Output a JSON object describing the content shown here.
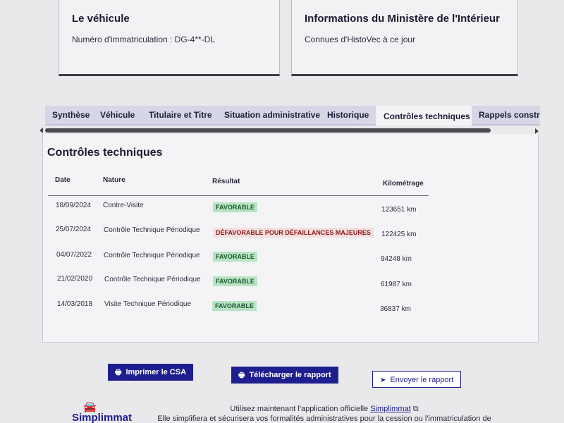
{
  "vehicle_card": {
    "title": "Le véhicule",
    "plate_line": "Numéro d'immatriculation : DG-4**-DL"
  },
  "ministry_card": {
    "title": "Informations du Ministère de l'Intérieur",
    "subtitle": "Connues d'HistoVec à ce jour"
  },
  "tabs": [
    {
      "label": "Synthèse"
    },
    {
      "label": "Véhicule"
    },
    {
      "label": "Titulaire et Titre"
    },
    {
      "label": "Situation administrative"
    },
    {
      "label": "Historique"
    },
    {
      "label": "Contrôles techniques",
      "active": true
    },
    {
      "label": "Rappels constructeur"
    }
  ],
  "section": {
    "title": "Contrôles techniques",
    "columns": {
      "date": "Date",
      "nature": "Nature",
      "result": "Résultat",
      "mileage": "Kilométrage"
    },
    "rows": [
      {
        "date": "18/09/2024",
        "nature": "Contre-Visite",
        "result": "FAVORABLE",
        "status": "ok",
        "mileage": "123651 km"
      },
      {
        "date": "25/07/2024",
        "nature": "Contrôle Technique Périodique",
        "result": "DÉFAVORABLE POUR DÉFAILLANCES MAJEURES",
        "status": "ko",
        "mileage": "122425 km"
      },
      {
        "date": "04/07/2022",
        "nature": "Contrôle Technique Périodique",
        "result": "FAVORABLE",
        "status": "ok",
        "mileage": "94248 km"
      },
      {
        "date": "21/02/2020",
        "nature": "Contrôle Technique Périodique",
        "result": "FAVORABLE",
        "status": "ok",
        "mileage": "61987 km"
      },
      {
        "date": "14/03/2018",
        "nature": "Visite Technique Périodique",
        "result": "FAVORABLE",
        "status": "ok",
        "mileage": "36837 km"
      }
    ]
  },
  "actions": {
    "print_label": "Imprimer le CSA",
    "download_label": "Télécharger le rapport",
    "send_label": "Envoyer le rapport"
  },
  "footer": {
    "brand": "Simplimmat",
    "line1_prefix": "Utilisez maintenant l'application officielle ",
    "line1_link": "Simplimmat",
    "line2": "Elle simplifiera et sécurisera vos formalités administratives pour la cession ou l'immatriculation de"
  },
  "colors": {
    "primary": "#1e1e8f",
    "favorable": "#b8e3c4",
    "defavorable_text": "#8a1a1a"
  }
}
